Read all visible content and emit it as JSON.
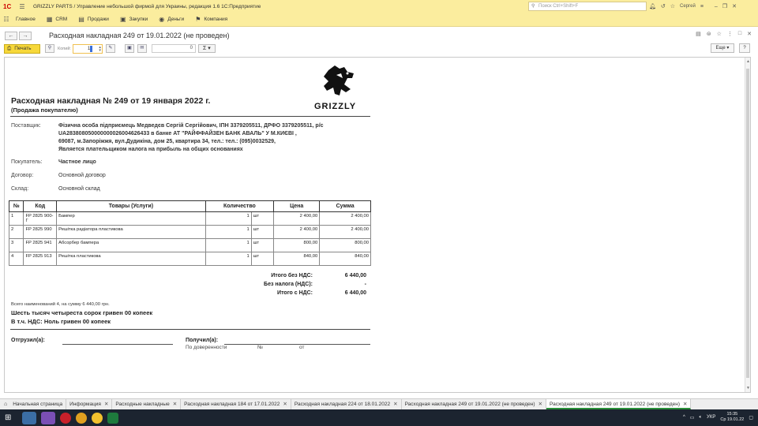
{
  "titlebar": {
    "logo": "1С",
    "title": "GRIZZLY PARTS / Управление небольшой фирмой для Украины, редакция 1.6 1С:Предприятие",
    "search_placeholder": "Поиск Ctrl+Shift+F",
    "user": "Сергей"
  },
  "menu": [
    {
      "icon": "home-icon",
      "label": "Главное"
    },
    {
      "icon": "crm-icon",
      "label": "CRM"
    },
    {
      "icon": "sales-icon",
      "label": "Продажи"
    },
    {
      "icon": "purchases-icon",
      "label": "Закупки"
    },
    {
      "icon": "money-icon",
      "label": "Деньги"
    },
    {
      "icon": "company-icon",
      "label": "Компания"
    }
  ],
  "doc": {
    "window_title": "Расходная накладная 249 от 19.01.2022 (не проведен)",
    "print_label": "Печать",
    "copies_label": "Копий:",
    "copies_value": "1",
    "sum_value": "0",
    "sigma": "Σ",
    "more_label": "Еще",
    "help_label": "?"
  },
  "invoice": {
    "title": "Расходная накладная № 249 от 19 января 2022 г.",
    "subtitle": "(Продажа покупателю)",
    "brand": "GRIZZLY",
    "supplier_label": "Поставщик:",
    "supplier_line1": "Фізична особа підприємець Медведєв Сергій Сергійович,  ІПН 3379205511,  ДРФО 3379205511, р/с",
    "supplier_line2": "UA283808050000000026004626433 в банке АТ \"РАЙФФАЙЗЕН БАНК АВАЛЬ\" У М.КИЄВІ                ,",
    "supplier_line3": "69087, м.Запоріжжя, вул.Дудикіна, дом 25, квартира 34,  тел.: тел.: (095)0032529,",
    "supplier_line4": "Является плательщиком налога на прибыль на общих основаниях",
    "buyer_label": "Покупатель:",
    "buyer": "Частное лицо",
    "contract_label": "Договор:",
    "contract": "Основной договор",
    "warehouse_label": "Склад:",
    "warehouse": "Основной склад",
    "columns": [
      "№",
      "Код",
      "Товары (Услуги)",
      "Количество",
      "",
      "Цена",
      "Сумма"
    ],
    "rows": [
      {
        "n": "1",
        "code": "FP 2825 900-Г",
        "name": "Бампер",
        "qty": "1",
        "unit": "шт",
        "price": "2 400,00",
        "sum": "2 400,00"
      },
      {
        "n": "2",
        "code": "FP 2825 990",
        "name": "Решітка радіатора пластикова",
        "qty": "1",
        "unit": "шт",
        "price": "2 400,00",
        "sum": "2 400,00"
      },
      {
        "n": "3",
        "code": "FP 2825 941",
        "name": "Абсорбер бампера",
        "qty": "1",
        "unit": "шт",
        "price": "800,00",
        "sum": "800,00"
      },
      {
        "n": "4",
        "code": "FP 2825 913",
        "name": "Решітка пластикова",
        "qty": "1",
        "unit": "шт",
        "price": "840,00",
        "sum": "840,00"
      }
    ],
    "total_no_vat_label": "Итого без НДС:",
    "total_no_vat": "6 440,00",
    "no_tax_label": "Без налога (НДС):",
    "no_tax": "-",
    "total_vat_label": "Итого с НДС:",
    "total_vat": "6 440,00",
    "count_note": "Всего наименований 4, на сумму 6 440,00 грн.",
    "sum_words": "Шесть тысяч четыреста сорок гривен 00 копеек",
    "vat_words": "В т.ч. НДС: Ноль гривен 00 копеек",
    "shipped_label": "Отгрузил(а):",
    "received_label": "Получил(а):",
    "proxy_label": "По доверенности",
    "num_label": "№",
    "from_label": "от"
  },
  "tabs": [
    {
      "label": "Начальная страница",
      "closable": false
    },
    {
      "label": "Информация",
      "closable": true
    },
    {
      "label": "Расходные накладные",
      "closable": true
    },
    {
      "label": "Расходная накладная 184 от 17.01.2022",
      "closable": true
    },
    {
      "label": "Расходная накладная 224 от 18.01.2022",
      "closable": true
    },
    {
      "label": "Расходная накладная 249 от 19.01.2022 (не проведен)",
      "closable": true
    },
    {
      "label": "Расходная накладная 249 от 19.01.2022 (не проведен)",
      "closable": true,
      "active": true
    }
  ],
  "taskbar": {
    "lang": "УКР",
    "time": "15:35",
    "date": "Ср 19.01.22"
  },
  "colors": {
    "chrome": "#fbed9e",
    "print_button": "#f7d83a",
    "active_tab": "#2a8f3a"
  }
}
